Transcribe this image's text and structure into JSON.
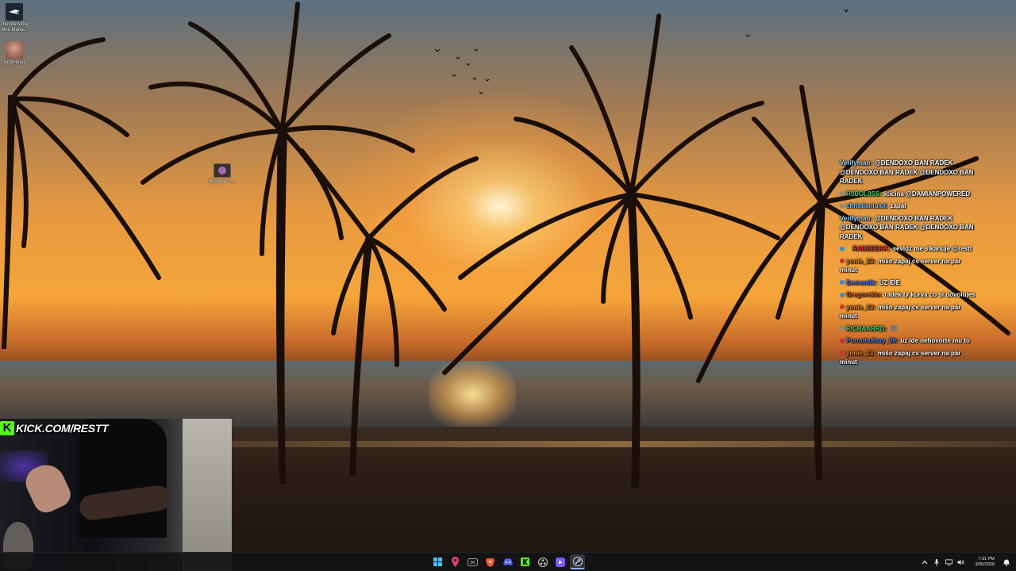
{
  "desktop": {
    "icons": [
      {
        "label": "Thunderstore Mod Mana...",
        "icon": "thunderstore-icon"
      },
      {
        "label": "resttHead",
        "icon": "user-photo-icon"
      },
      {
        "label": "Bugonia+2...",
        "icon": "video-file-icon"
      }
    ]
  },
  "stream_overlay": {
    "kick_url": "KICK.COM/RESTT",
    "kick_logo": "K"
  },
  "chat": {
    "messages": [
      {
        "user": "Verifyman:",
        "user_color": "#9fd8ff",
        "text": "@DENDOXO BAN RADEK @DENDOXO BAN RADEK @DENDOXO BAN RADEK"
      },
      {
        "user": "R0BOL0SS:",
        "user_color": "#3fd26e",
        "text": "Icicina @DAMIANPOWERED"
      },
      {
        "user": "christianlulul:",
        "user_color": "#7ec8ff",
        "text": "zapal"
      },
      {
        "user": "Verifyman:",
        "user_color": "#9fd8ff",
        "text": "@DENDOXO BAN RADEK @DENDOXO BAN RADEK @DENDOXO BAN RADEK"
      },
      {
        "user": "RADEEEKK:",
        "user_color": "#e23a3a",
        "text": "sevidz me sikanuje @restt"
      },
      {
        "user": "yonie_23:",
        "user_color": "#d28a2a",
        "text": "mišo zapaj cs server na pár minut"
      },
      {
        "user": "Dementik:",
        "user_color": "#5a7aff",
        "text": "UZ IDE"
      },
      {
        "user": "Gregorekio:",
        "user_color": "#e05a2a",
        "text": "radek ty kurva co si dovolujes"
      },
      {
        "user": "yonie_23:",
        "user_color": "#d28a2a",
        "text": "mišo zapaj cs server na pár minut"
      },
      {
        "user": "RICHAARRD:",
        "user_color": "#3fd26e",
        "text": ""
      },
      {
        "user": "Pornoholbuy_69:",
        "user_color": "#4a8aff",
        "text": "uz ide nehovorte mu to"
      },
      {
        "user": "yonie_23:",
        "user_color": "#d28a2a",
        "text": "mišo zapaj cs server na pár minut"
      }
    ]
  },
  "taskbar": {
    "apps": [
      {
        "name": "windows-start",
        "color": "#4cc2ff"
      },
      {
        "name": "maps-pin",
        "color": "#e0407a"
      },
      {
        "name": "xbox-app",
        "color": "#9a9a9a"
      },
      {
        "name": "brave-browser",
        "color": "#fb542b"
      },
      {
        "name": "discord",
        "color": "#5865f2"
      },
      {
        "name": "kick-app",
        "color": "#53fc18"
      },
      {
        "name": "obs-studio",
        "color": "#cfcfcf"
      },
      {
        "name": "streamer-app",
        "color": "#7b5cff"
      },
      {
        "name": "steam",
        "color": "#1b2838",
        "active": true
      }
    ],
    "clock_time": "7:31 PM",
    "clock_date": "3/30/2026"
  }
}
